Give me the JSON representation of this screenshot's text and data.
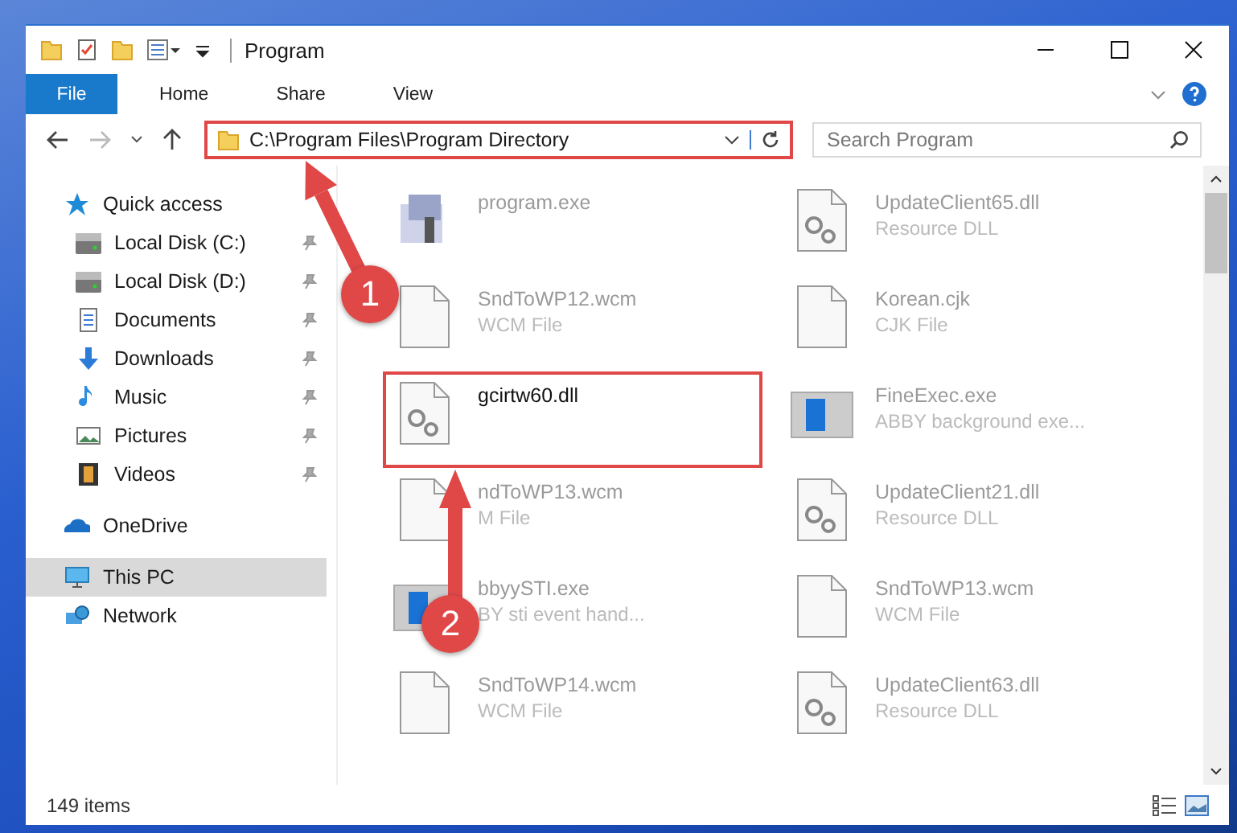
{
  "window": {
    "title": "Program"
  },
  "ribbon": {
    "tabs": [
      {
        "label": "File",
        "selected": true
      },
      {
        "label": "Home",
        "selected": false
      },
      {
        "label": "Share",
        "selected": false
      },
      {
        "label": "View",
        "selected": false
      }
    ]
  },
  "address": {
    "path": "C:\\Program Files\\Program Directory",
    "highlighted": true
  },
  "search": {
    "placeholder": "Search Program"
  },
  "sidebar": {
    "items": [
      {
        "label": "Quick access",
        "kind": "star",
        "selected": false,
        "children": [
          {
            "label": "Local Disk (C:)",
            "kind": "disk",
            "selected": false,
            "pinned": true
          },
          {
            "label": "Local Disk (D:)",
            "kind": "disk",
            "selected": false,
            "pinned": true
          },
          {
            "label": "Documents",
            "kind": "documents",
            "selected": false,
            "pinned": true
          },
          {
            "label": "Downloads",
            "kind": "downloads",
            "selected": false,
            "pinned": true
          },
          {
            "label": "Music",
            "kind": "music",
            "selected": false,
            "pinned": true
          },
          {
            "label": "Pictures",
            "kind": "pictures",
            "selected": false,
            "pinned": true
          },
          {
            "label": "Videos",
            "kind": "videos",
            "selected": false,
            "pinned": true
          }
        ]
      },
      {
        "label": "OneDrive",
        "kind": "cloud",
        "selected": false
      },
      {
        "label": "This PC",
        "kind": "pc",
        "selected": true
      },
      {
        "label": "Network",
        "kind": "network",
        "selected": false
      }
    ]
  },
  "files": [
    {
      "name": "program.exe",
      "kind": "exe",
      "highlighted": false
    },
    {
      "name": "UpdateClient65.dll",
      "type": "Resource DLL",
      "kind": "dll",
      "highlighted": false
    },
    {
      "name": "SndToWP12.wcm",
      "type": "WCM File",
      "kind": "doc",
      "highlighted": false
    },
    {
      "name": "Korean.cjk",
      "type": "CJK File",
      "kind": "doc",
      "highlighted": false
    },
    {
      "name": "gcirtw60.dll",
      "kind": "dll",
      "highlighted": true
    },
    {
      "name": "FineExec.exe",
      "type": "ABBY background exe...",
      "kind": "app",
      "highlighted": false
    },
    {
      "name": "ndToWP13.wcm",
      "type": "M File",
      "kind": "doc",
      "highlighted": false
    },
    {
      "name": "UpdateClient21.dll",
      "type": "Resource DLL",
      "kind": "dll",
      "highlighted": false
    },
    {
      "name": "bbyySTI.exe",
      "type": "BY sti event hand...",
      "kind": "app",
      "highlighted": false
    },
    {
      "name": "SndToWP13.wcm",
      "type": "WCM File",
      "kind": "doc",
      "highlighted": false
    },
    {
      "name": "SndToWP14.wcm",
      "type": "WCM File",
      "kind": "doc",
      "highlighted": false
    },
    {
      "name": "UpdateClient63.dll",
      "type": "Resource DLL",
      "kind": "dll",
      "highlighted": false
    }
  ],
  "status_bar": {
    "count": "149 items"
  },
  "callouts": [
    {
      "label": "1"
    },
    {
      "label": "2"
    }
  ]
}
